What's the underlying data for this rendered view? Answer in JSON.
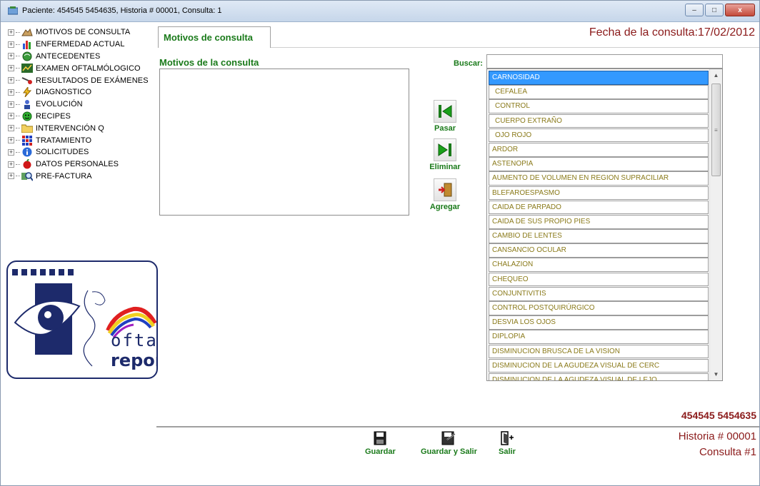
{
  "window": {
    "title": "Paciente: 454545 5454635, Historia # 00001, Consulta: 1",
    "minimize": "–",
    "maximize": "□",
    "close": "x"
  },
  "tree": [
    {
      "label": "MOTIVOS DE CONSULTA",
      "icon": "hands-icon"
    },
    {
      "label": "ENFERMEDAD ACTUAL",
      "icon": "bar-chart-icon"
    },
    {
      "label": "ANTECEDENTES",
      "icon": "globe-icon"
    },
    {
      "label": "EXAMEN OFTALMÓLOGICO",
      "icon": "chart-icon"
    },
    {
      "label": "RESULTADOS DE EXÁMENES",
      "icon": "microscope-icon"
    },
    {
      "label": "DIAGNOSTICO",
      "icon": "lightning-icon"
    },
    {
      "label": "EVOLUCIÓN",
      "icon": "person-icon"
    },
    {
      "label": "RECIPES",
      "icon": "smiley-icon"
    },
    {
      "label": "INTERVENCIÓN Q",
      "icon": "folder-icon"
    },
    {
      "label": "TRATAMIENTO",
      "icon": "grid-icon"
    },
    {
      "label": "SOLICITUDES",
      "icon": "info-icon"
    },
    {
      "label": "DATOS PERSONALES",
      "icon": "apple-icon"
    },
    {
      "label": "PRE-FACTURA",
      "icon": "magnifier-icon"
    }
  ],
  "logo": {
    "line1": "oftal",
    "line2": "report"
  },
  "tab": {
    "label": "Motivos de consulta"
  },
  "fecha": "Fecha de la consulta:17/02/2012",
  "motivos": {
    "label": "Motivos de la consulta"
  },
  "buscar": {
    "label": "Buscar:",
    "value": ""
  },
  "side_buttons": {
    "pasar": "Pasar",
    "eliminar": "Eliminar",
    "agregar": "Agregar"
  },
  "list": [
    "CARNOSIDAD",
    "CEFALEA",
    "CONTROL",
    "CUERPO EXTRAÑO",
    "OJO ROJO",
    "ARDOR",
    "ASTENOPIA",
    "AUMENTO DE VOLUMEN EN REGION SUPRACILIAR",
    "BLEFAROESPASMO",
    "CAIDA DE PARPADO",
    "CAIDA DE SUS PROPIO PIES",
    "CAMBIO DE LENTES",
    "CANSANCIO OCULAR",
    "CHALAZION",
    "CHEQUEO",
    "CONJUNTIVITIS",
    "CONTROL POSTQUIRÚRGICO",
    "DESVIA LOS OJOS",
    "DIPLOPIA",
    "DISMINUCION BRUSCA DE LA VISION",
    "DISMINUCION DE LA AGUDEZA VISUAL DE CERC",
    "DISMINUCION DE LA AGUDEZA VISUAL DE LEJO"
  ],
  "patient": {
    "id": "454545 5454635",
    "historia": "Historia # 00001",
    "consulta": "Consulta #1"
  },
  "bottom_buttons": {
    "guardar": "Guardar",
    "guardar_salir": "Guardar y Salir",
    "salir": "Salir"
  },
  "colors": {
    "accent_green": "#1a7a1a",
    "accent_red": "#8b1a1a",
    "selection_blue": "#3399ff",
    "list_text": "#8a7a1a"
  }
}
